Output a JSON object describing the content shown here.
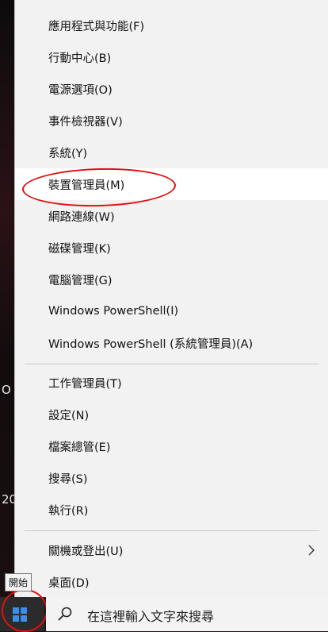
{
  "menu": {
    "items": [
      {
        "label": "應用程式與功能(F)"
      },
      {
        "label": "行動中心(B)"
      },
      {
        "label": "電源選項(O)"
      },
      {
        "label": "事件檢視器(V)"
      },
      {
        "label": "系統(Y)"
      },
      {
        "label": "裝置管理員(M)"
      },
      {
        "label": "網路連線(W)"
      },
      {
        "label": "磁碟管理(K)"
      },
      {
        "label": "電腦管理(G)"
      },
      {
        "label": "Windows PowerShell(I)"
      },
      {
        "label": "Windows PowerShell (系統管理員)(A)"
      },
      {
        "label": "工作管理員(T)"
      },
      {
        "label": "設定(N)"
      },
      {
        "label": "檔案總管(E)"
      },
      {
        "label": "搜尋(S)"
      },
      {
        "label": "執行(R)"
      },
      {
        "label": "關機或登出(U)"
      },
      {
        "label": "桌面(D)"
      }
    ]
  },
  "desktop": {
    "edge_text_1": "O",
    "edge_text_2": "20"
  },
  "taskbar": {
    "start_tooltip": "開始",
    "search_placeholder": "在這裡輸入文字來搜尋"
  },
  "colors": {
    "annotation": "#e01010",
    "menu_bg": "#f2f2f2",
    "hover_bg": "#ffffff"
  }
}
